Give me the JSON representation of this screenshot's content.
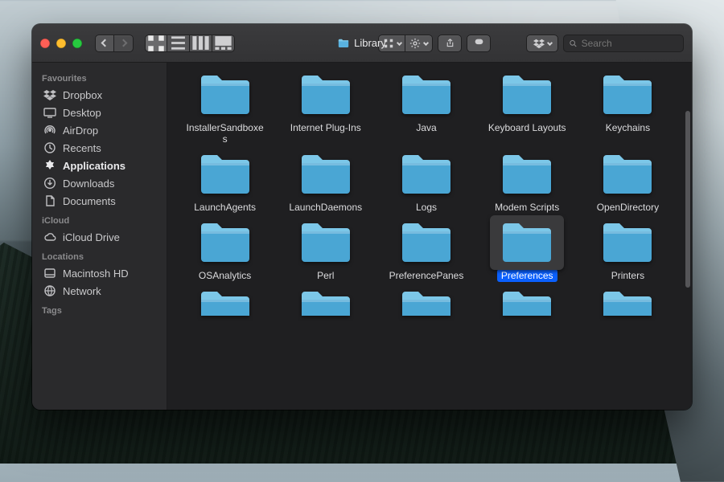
{
  "window": {
    "title": "Library"
  },
  "toolbar": {
    "search_placeholder": "Search"
  },
  "sidebar": {
    "sections": [
      {
        "title": "Favourites",
        "items": [
          {
            "label": "Dropbox",
            "icon": "dropbox-icon"
          },
          {
            "label": "Desktop",
            "icon": "desktop-icon"
          },
          {
            "label": "AirDrop",
            "icon": "airdrop-icon"
          },
          {
            "label": "Recents",
            "icon": "recents-icon"
          },
          {
            "label": "Applications",
            "icon": "applications-icon",
            "bold": true
          },
          {
            "label": "Downloads",
            "icon": "downloads-icon"
          },
          {
            "label": "Documents",
            "icon": "documents-icon"
          }
        ]
      },
      {
        "title": "iCloud",
        "items": [
          {
            "label": "iCloud Drive",
            "icon": "icloud-icon"
          }
        ]
      },
      {
        "title": "Locations",
        "items": [
          {
            "label": "Macintosh HD",
            "icon": "disk-icon"
          },
          {
            "label": "Network",
            "icon": "network-icon"
          }
        ]
      },
      {
        "title": "Tags",
        "items": []
      }
    ]
  },
  "folders": [
    {
      "name": "InstallerSandboxes"
    },
    {
      "name": "Internet Plug-Ins"
    },
    {
      "name": "Java"
    },
    {
      "name": "Keyboard Layouts"
    },
    {
      "name": "Keychains"
    },
    {
      "name": "LaunchAgents"
    },
    {
      "name": "LaunchDaemons"
    },
    {
      "name": "Logs"
    },
    {
      "name": "Modem Scripts"
    },
    {
      "name": "OpenDirectory"
    },
    {
      "name": "OSAnalytics"
    },
    {
      "name": "Perl"
    },
    {
      "name": "PreferencePanes"
    },
    {
      "name": "Preferences",
      "selected": true
    },
    {
      "name": "Printers"
    }
  ],
  "colors": {
    "folder_top": "#7cc7e8",
    "folder_body": "#4aa6d4",
    "accent": "#0a60ff"
  }
}
